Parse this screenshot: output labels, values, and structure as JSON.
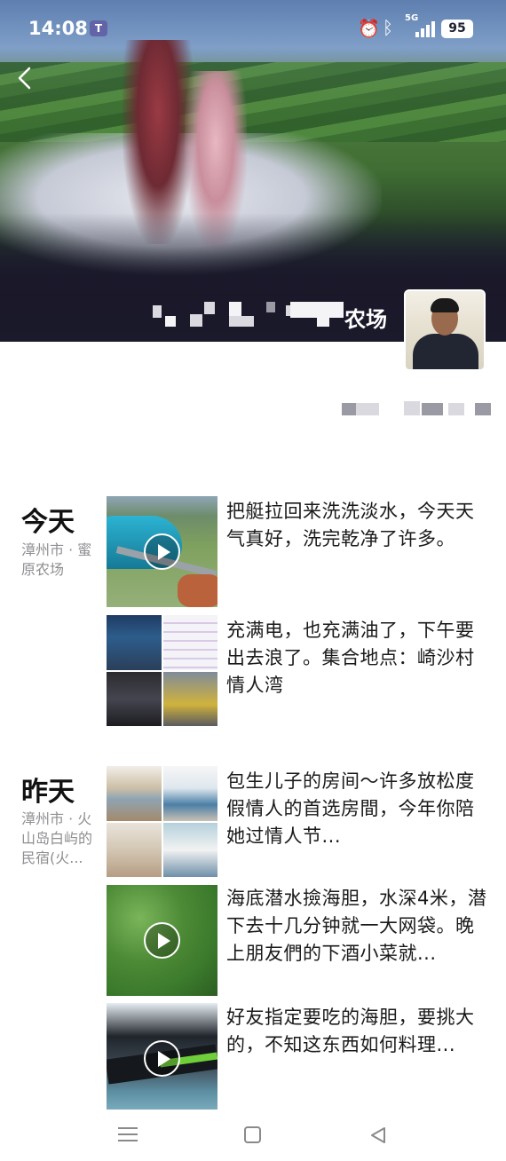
{
  "status_bar": {
    "time": "14:08",
    "app_badge": "T",
    "network": "5G",
    "battery": "95"
  },
  "profile": {
    "name_visible": "农场",
    "avatar_icon": "avatar-photo"
  },
  "feed": [
    {
      "day": "今天",
      "location": "漳州市 · 蜜原农场",
      "posts": [
        {
          "text": "把艇拉回来洗洗淡水，今天天气真好，洗完乾净了许多。",
          "media": "video"
        },
        {
          "text": "充满电，也充满油了，下午要出去浪了。集合地点：崎沙村 情人湾",
          "media": "photo-grid"
        }
      ]
    },
    {
      "day": "昨天",
      "location": "漳州市 · 火山岛白屿的民宿(火...",
      "posts": [
        {
          "text": "包生儿子的房间～许多放松度假情人的首选房間，今年你陪她过情人节...",
          "media": "photo-grid"
        },
        {
          "text": "海底潜水撿海胆，水深4米，潜下去十几分钟就一大网袋。晚上朋友們的下酒小菜就...",
          "media": "video"
        },
        {
          "text": "好友指定要吃的海胆，要挑大的，不知这东西如何料理...",
          "media": "video"
        }
      ]
    }
  ],
  "nav": {
    "menu_icon": "menu-icon",
    "home_icon": "home-icon",
    "back_icon": "back-triangle-icon"
  }
}
